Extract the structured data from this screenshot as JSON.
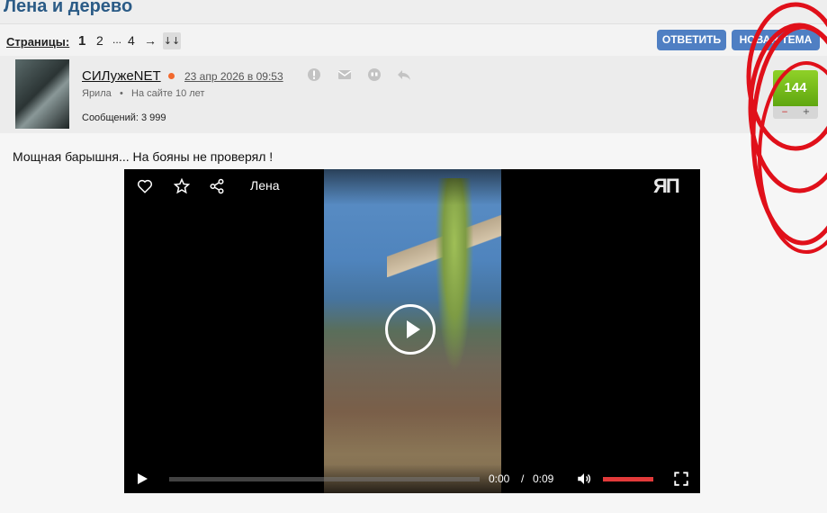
{
  "topic": {
    "title": "Лена и дерево"
  },
  "pagination": {
    "label": "Страницы:",
    "current": "1",
    "pages": [
      "2",
      "...",
      "4"
    ],
    "next_arrow": "→",
    "sort_toggle": "↓↓"
  },
  "actions": {
    "reply_label": "ОТВЕТИТЬ",
    "new_topic_label": "НОВАЯ ТЕМА"
  },
  "post": {
    "author": "СИЛужеNET",
    "date": "23 апр 2026 в 09:53",
    "group": "Ярила",
    "bullet": "•",
    "on_site": "На сайте 10 лет",
    "messages": "Сообщений: 3 999",
    "rating": "144",
    "rate_minus": "−",
    "rate_plus": "+",
    "text": "Мощная барышня... На бояны не проверял !"
  },
  "video": {
    "title": "Лена",
    "logo": "ЯП",
    "time_current": "0:00",
    "time_separator": "/",
    "time_total": "0:09",
    "progress_fraction": 0,
    "volume_fraction": 1
  },
  "colors": {
    "accent": "#4f7fc3",
    "title": "#2b5b86",
    "rating_green": "#6cb419",
    "progress_red": "#e23a3a",
    "annotation_red": "#e0101a"
  }
}
